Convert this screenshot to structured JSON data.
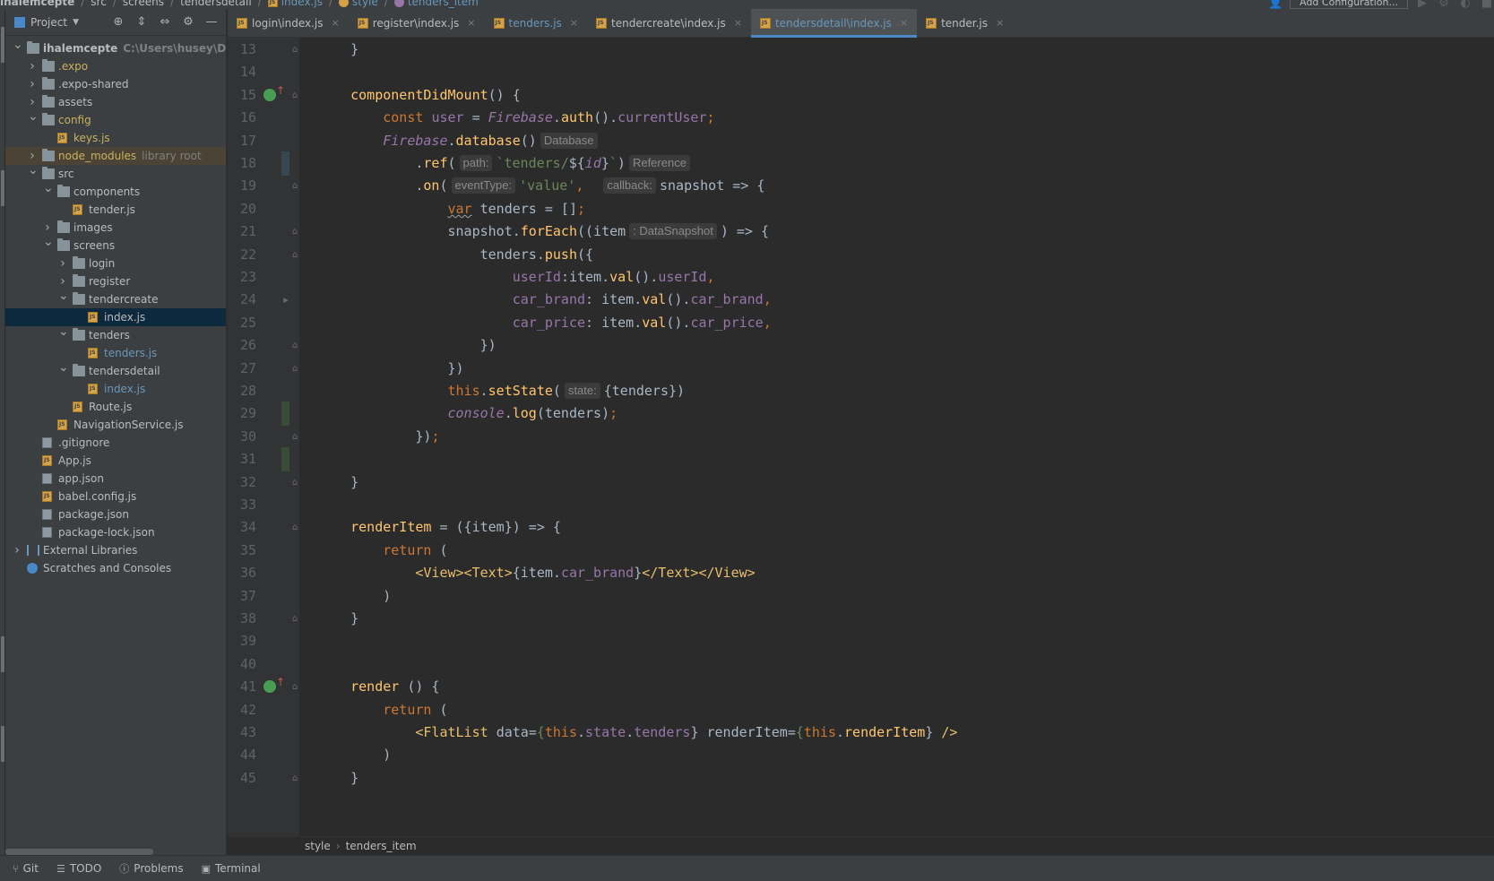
{
  "navbar": {
    "crumbs": [
      "ihalemcepte",
      "src",
      "screens",
      "tendersdetail",
      "index.js",
      "style",
      "tenders_item"
    ],
    "add_config_label": "Add Configuration..."
  },
  "project": {
    "title": "Project",
    "tree": [
      {
        "label": "ihalemcepte",
        "hint": "C:\\Users\\husey\\Desktop\\",
        "depth": 0,
        "arrow": "down",
        "icon": "folder",
        "bold": true
      },
      {
        "label": ".expo",
        "depth": 1,
        "arrow": "right",
        "icon": "folder",
        "color": "yellow"
      },
      {
        "label": ".expo-shared",
        "depth": 1,
        "arrow": "right",
        "icon": "folder"
      },
      {
        "label": "assets",
        "depth": 1,
        "arrow": "right",
        "icon": "folder"
      },
      {
        "label": "config",
        "depth": 1,
        "arrow": "down",
        "icon": "folder",
        "color": "yellow"
      },
      {
        "label": "keys.js",
        "depth": 2,
        "icon": "js",
        "color": "yellow"
      },
      {
        "label": "node_modules",
        "hint": "library root",
        "depth": 1,
        "arrow": "right",
        "icon": "folder",
        "color": "yellow",
        "lib": true
      },
      {
        "label": "src",
        "depth": 1,
        "arrow": "down",
        "icon": "folder"
      },
      {
        "label": "components",
        "depth": 2,
        "arrow": "down",
        "icon": "folder"
      },
      {
        "label": "tender.js",
        "depth": 3,
        "icon": "js"
      },
      {
        "label": "images",
        "depth": 2,
        "arrow": "right",
        "icon": "folder"
      },
      {
        "label": "screens",
        "depth": 2,
        "arrow": "down",
        "icon": "folder"
      },
      {
        "label": "login",
        "depth": 3,
        "arrow": "right",
        "icon": "folder"
      },
      {
        "label": "register",
        "depth": 3,
        "arrow": "right",
        "icon": "folder"
      },
      {
        "label": "tendercreate",
        "depth": 3,
        "arrow": "down",
        "icon": "folder"
      },
      {
        "label": "index.js",
        "depth": 4,
        "icon": "js",
        "selected": true
      },
      {
        "label": "tenders",
        "depth": 3,
        "arrow": "down",
        "icon": "folder"
      },
      {
        "label": "tenders.js",
        "depth": 4,
        "icon": "js",
        "color": "blue"
      },
      {
        "label": "tendersdetail",
        "depth": 3,
        "arrow": "down",
        "icon": "folder"
      },
      {
        "label": "index.js",
        "depth": 4,
        "icon": "js",
        "color": "blue"
      },
      {
        "label": "Route.js",
        "depth": 3,
        "icon": "js"
      },
      {
        "label": "NavigationService.js",
        "depth": 2,
        "icon": "js"
      },
      {
        "label": ".gitignore",
        "depth": 1,
        "icon": "cfg"
      },
      {
        "label": "App.js",
        "depth": 1,
        "icon": "js"
      },
      {
        "label": "app.json",
        "depth": 1,
        "icon": "cfg"
      },
      {
        "label": "babel.config.js",
        "depth": 1,
        "icon": "js"
      },
      {
        "label": "package.json",
        "depth": 1,
        "icon": "cfg"
      },
      {
        "label": "package-lock.json",
        "depth": 1,
        "icon": "cfg"
      },
      {
        "label": "External Libraries",
        "depth": 0,
        "arrow": "right",
        "icon": "lib"
      },
      {
        "label": "Scratches and Consoles",
        "depth": 0,
        "icon": "scratch"
      }
    ]
  },
  "tabs": [
    {
      "label": "login\\index.js",
      "active": false
    },
    {
      "label": "register\\index.js",
      "active": false
    },
    {
      "label": "tenders.js",
      "active": false,
      "color": "blue"
    },
    {
      "label": "tendercreate\\index.js",
      "active": false
    },
    {
      "label": "tendersdetail\\index.js",
      "active": true
    },
    {
      "label": "tender.js",
      "active": false
    }
  ],
  "editor": {
    "lines": [
      {
        "n": "13",
        "html": "    }",
        "fold": "⊖"
      },
      {
        "n": "14",
        "html": ""
      },
      {
        "n": "15",
        "html": "    <span class=\"fn\">componentDidMount</span>() {",
        "fold": "⊖",
        "override": true
      },
      {
        "n": "16",
        "html": "        <span class=\"kw\">const</span> <span class=\"prop\">user</span> = <span class=\"cls\">Firebase</span>.<span class=\"fn\">auth</span>().<span class=\"prop\">currentUser</span><span class=\"semi\">;</span>"
      },
      {
        "n": "17",
        "html": "        <span class=\"cls\">Firebase</span>.<span class=\"fn\">database</span>()<span class=\"hint-box\">Database</span>"
      },
      {
        "n": "18",
        "html": "            .<span class=\"fn\">ref</span>(<span class=\"hint-box\">path:</span><span class=\"str\">`tenders/</span>${<span class=\"cls\">id</span>}<span class=\"str\">`</span>)<span class=\"hint-box\">Reference</span>",
        "vcs": "mod"
      },
      {
        "n": "19",
        "html": "            .<span class=\"fn\">on</span>(<span class=\"hint-box\">eventType:</span><span class=\"str\">'value'</span><span class=\"semi\">,</span>  <span class=\"hint-box\">callback:</span>snapshot => {",
        "fold": "⊖"
      },
      {
        "n": "20",
        "html": "                <span class=\"kw wavy\">var</span> tenders = []<span class=\"semi\">;</span>"
      },
      {
        "n": "21",
        "html": "                snapshot.<span class=\"fn\">forEach</span>((item<span class=\"hint-box\">: DataSnapshot</span>) => {",
        "fold": "⊖"
      },
      {
        "n": "22",
        "html": "                    tenders.<span class=\"fn\">push</span>({",
        "fold": "⊖"
      },
      {
        "n": "23",
        "html": "                        <span class=\"prop\">userId</span>:item.<span class=\"fn\">val</span>().<span class=\"prop\">userId</span><span class=\"semi\">,</span>"
      },
      {
        "n": "24",
        "html": "                        <span class=\"prop\">car_brand</span>: item.<span class=\"fn\">val</span>().<span class=\"prop\">car_brand</span><span class=\"semi\">,</span>",
        "fold": "▸"
      },
      {
        "n": "25",
        "html": "                        <span class=\"prop\">car_price</span>: item.<span class=\"fn\">val</span>().<span class=\"prop\">car_price</span><span class=\"semi\">,</span>"
      },
      {
        "n": "26",
        "html": "                    })",
        "fold": "⊖"
      },
      {
        "n": "27",
        "html": "                })",
        "fold": "⊖"
      },
      {
        "n": "28",
        "html": "                <span class=\"kw\">this</span>.<span class=\"fn\">setState</span>(<span class=\"hint-box\">state:</span>{tenders})"
      },
      {
        "n": "29",
        "html": "                <span class=\"cls\">console</span>.<span class=\"fn\">log</span>(tenders)<span class=\"semi\">;</span>",
        "vcs": "add"
      },
      {
        "n": "30",
        "html": "            })<span class=\"semi\">;</span>",
        "fold": "⊖"
      },
      {
        "n": "31",
        "html": "",
        "vcs": "add"
      },
      {
        "n": "32",
        "html": "    }",
        "fold": "⊖"
      },
      {
        "n": "33",
        "html": ""
      },
      {
        "n": "34",
        "html": "    <span class=\"fn\">renderItem</span> = ({item}) => {",
        "fold": "⊖"
      },
      {
        "n": "35",
        "html": "        <span class=\"kw\">return</span> ("
      },
      {
        "n": "36",
        "html": "            <span class=\"tag\">&lt;View&gt;&lt;Text&gt;</span>{item.<span class=\"prop\">car_brand</span>}<span class=\"tag\">&lt;/Text&gt;&lt;/View&gt;</span>"
      },
      {
        "n": "37",
        "html": "        )"
      },
      {
        "n": "38",
        "html": "    }",
        "fold": "⊖"
      },
      {
        "n": "39",
        "html": ""
      },
      {
        "n": "40",
        "html": ""
      },
      {
        "n": "41",
        "html": "    <span class=\"fn\">render</span> () {",
        "fold": "⊖",
        "override": true
      },
      {
        "n": "42",
        "html": "        <span class=\"kw\">return</span> ("
      },
      {
        "n": "43",
        "html": "            <span class=\"tag\">&lt;FlatList</span> <span class=\"id\">data</span>=<span class=\"str\">{</span><span class=\"kw\">this</span>.<span class=\"prop\">state</span>.<span class=\"prop\">tenders</span>} <span class=\"id\">renderItem</span>=<span class=\"str\">{</span><span class=\"kw\">this</span>.<span class=\"fn\">renderItem</span>} <span class=\"tag\">/&gt;</span>"
      },
      {
        "n": "44",
        "html": "        )"
      },
      {
        "n": "45",
        "html": "    }",
        "fold": "⊖"
      }
    ]
  },
  "breadcrumb": [
    "style",
    "tenders_item"
  ],
  "statusbar": [
    {
      "label": "Git",
      "icon": "git-icon"
    },
    {
      "label": "TODO",
      "icon": "todo-icon"
    },
    {
      "label": "Problems",
      "icon": "problems-icon"
    },
    {
      "label": "Terminal",
      "icon": "terminal-icon"
    }
  ]
}
